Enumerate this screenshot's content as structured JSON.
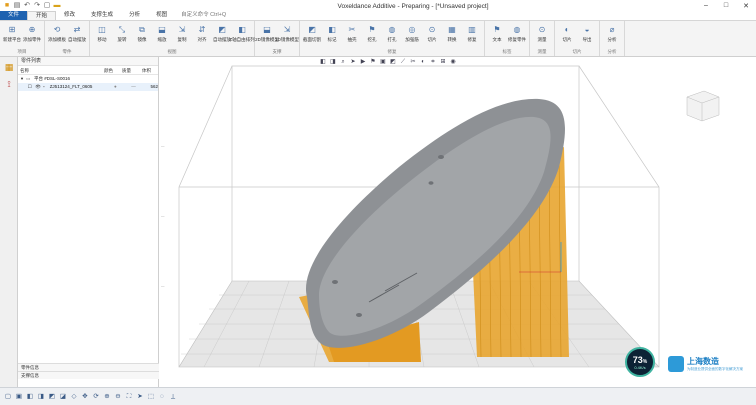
{
  "app": {
    "title": "Voxeldance Additive - Preparing - [*Unsaved project]",
    "file_tab": "文件",
    "tabs": [
      "开始",
      "修改",
      "支撑生成",
      "分析",
      "视图"
    ],
    "active_tab": "开始",
    "hint": "自定义命令 Ctrl+Q"
  },
  "ribbon": {
    "groups": [
      {
        "label": "项目",
        "buttons": [
          "新建平台",
          "添加零件"
        ]
      },
      {
        "label": "零件",
        "buttons": [
          "添加模板",
          "自动摆放"
        ]
      },
      {
        "label": "视图",
        "buttons": [
          "移动",
          "旋转",
          "镜像",
          "缩放",
          "复制",
          "对齐",
          "自动摆放",
          "Z轴自由排列"
        ]
      },
      {
        "label": "支撑",
        "buttons": [
          "2D镜像模型",
          "3D镜像模型"
        ]
      },
      {
        "label": "修复",
        "buttons": [
          "截面切割",
          "标记",
          "抽壳",
          "挖孔",
          "打孔",
          "加强筋",
          "切片",
          "转换",
          "修复"
        ]
      },
      {
        "label": "标签",
        "buttons": [
          "文本",
          "修复零件"
        ]
      },
      {
        "label": "测量",
        "buttons": [
          "测量"
        ]
      },
      {
        "label": "切片",
        "buttons": [
          "切片",
          "导出"
        ]
      },
      {
        "label": "分析",
        "buttons": [
          "分析"
        ]
      }
    ]
  },
  "panel": {
    "title": "零件列表",
    "columns": [
      "名称",
      "颜色",
      "质量",
      "体积"
    ],
    "rows": [
      {
        "name": "平台 #DSL-S0016",
        "volume": ""
      },
      {
        "name": "ZJ513124_FLT_0605",
        "volume": "562"
      }
    ],
    "footer1": "零件信息",
    "footer2": "支撑信息"
  },
  "badge": {
    "value": "73",
    "unit": "%",
    "sub": "0.4K/s"
  },
  "logo": {
    "name": "上海数造",
    "sub": "为制造业提供全面的数字化解决方案"
  },
  "colors": {
    "accent": "#1e62b0",
    "support": "#e8a530",
    "model": "#8f9295",
    "grid": "#cfcfcf"
  }
}
